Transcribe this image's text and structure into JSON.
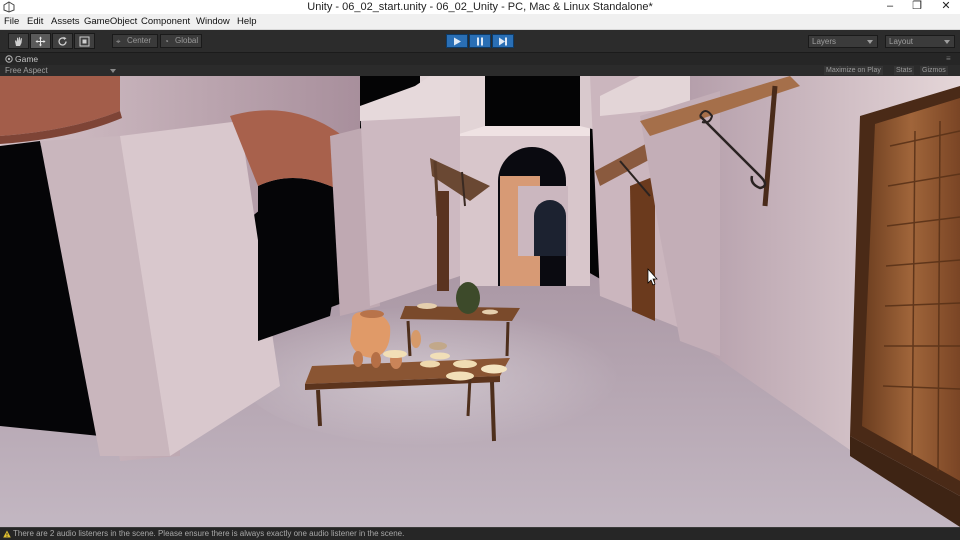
{
  "window": {
    "title": "Unity - 06_02_start.unity - 06_02_Unity - PC, Mac & Linux Standalone*",
    "minimize_glyph": "–",
    "maximize_glyph": "❐",
    "close_glyph": "✕"
  },
  "menubar": {
    "items": [
      "File",
      "Edit",
      "Assets",
      "GameObject",
      "Component",
      "Window",
      "Help"
    ]
  },
  "toolbar": {
    "tools": [
      "hand-icon",
      "move-icon",
      "rotate-icon",
      "scale-icon"
    ],
    "pivot_label": "Center",
    "space_label": "Global",
    "play_controls": [
      "play-icon",
      "pause-icon",
      "step-icon"
    ],
    "layers_label": "Layers",
    "layout_label": "Layout"
  },
  "game_view": {
    "tab_label": "Game",
    "aspect_label": "Free Aspect",
    "maximize_on_play": "Maximize on Play",
    "stats": "Stats",
    "gizmos": "Gizmos"
  },
  "status": {
    "message": "There are 2 audio listeners in the scene. Please ensure there is always exactly one audio listener in the scene."
  },
  "colors": {
    "play_active": "#2a6fb5",
    "editor_dark": "#2c2c2c",
    "warning": "#e0c030"
  }
}
